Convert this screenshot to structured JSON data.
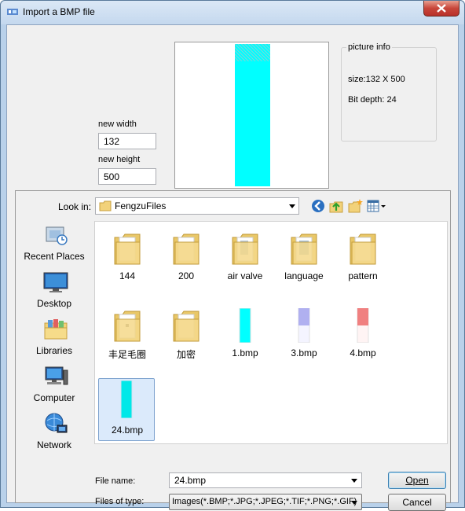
{
  "window": {
    "title": "Import a BMP file"
  },
  "size_fields": {
    "width_label": "new width",
    "width_value": "132",
    "height_label": "new height",
    "height_value": "500"
  },
  "picture_info": {
    "legend": "picture info",
    "size": "size:132 X 500",
    "bit_depth": "Bit depth: 24"
  },
  "dialog": {
    "look_in_label": "Look in:",
    "look_in_value": "FengzuFiles",
    "places": [
      {
        "label": "Recent Places",
        "icon": "recent-places-icon"
      },
      {
        "label": "Desktop",
        "icon": "desktop-icon"
      },
      {
        "label": "Libraries",
        "icon": "libraries-icon"
      },
      {
        "label": "Computer",
        "icon": "computer-icon"
      },
      {
        "label": "Network",
        "icon": "network-icon"
      }
    ],
    "files": [
      {
        "label": "144",
        "kind": "folder"
      },
      {
        "label": "200",
        "kind": "folder"
      },
      {
        "label": "air valve",
        "kind": "folder"
      },
      {
        "label": "language",
        "kind": "folder"
      },
      {
        "label": "pattern",
        "kind": "folder"
      },
      {
        "label": "丰足毛圈",
        "kind": "folder"
      },
      {
        "label": "加密",
        "kind": "folder"
      },
      {
        "label": "1.bmp",
        "kind": "bmp",
        "color": "#00ffff"
      },
      {
        "label": "3.bmp",
        "kind": "bmp",
        "color": "#b0b0f0"
      },
      {
        "label": "4.bmp",
        "kind": "bmp",
        "color": "#f08080"
      },
      {
        "label": "24.bmp",
        "kind": "bmp",
        "color": "#00e8e8",
        "selected": true
      }
    ],
    "file_name_label": "File name:",
    "file_name_value": "24.bmp",
    "file_type_label": "Files of type:",
    "file_type_value": "Images(*.BMP;*.JPG;*.JPEG;*.TIF;*.PNG;*.GIF)",
    "open_label": "Open",
    "cancel_label": "Cancel"
  },
  "colors": {
    "accent": "#3c7fb1",
    "selection": "#dbeafb",
    "preview_fill": "#00ffff"
  }
}
